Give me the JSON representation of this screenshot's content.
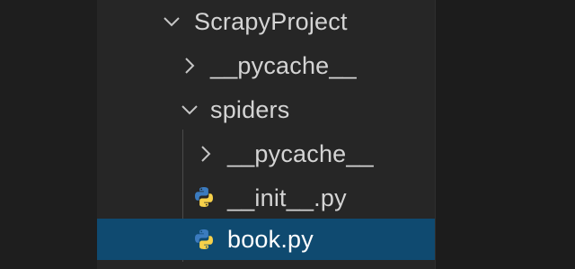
{
  "explorer": {
    "items": [
      {
        "label": "ScrapyProject",
        "expanded": true,
        "icon": "chevron-down-icon"
      },
      {
        "label": "__pycache__",
        "expanded": false,
        "icon": "chevron-right-icon"
      },
      {
        "label": "spiders",
        "expanded": true,
        "icon": "chevron-down-icon"
      },
      {
        "label": "__pycache__",
        "expanded": false,
        "icon": "chevron-right-icon"
      },
      {
        "label": "__init__.py",
        "icon": "python-file-icon"
      },
      {
        "label": "book.py",
        "icon": "python-file-icon",
        "selected": true
      }
    ]
  },
  "colors": {
    "selection": "#0f4a70",
    "text": "#d4d4d4",
    "python_blue": "#3b7bbf",
    "python_yellow": "#f7d14a"
  }
}
